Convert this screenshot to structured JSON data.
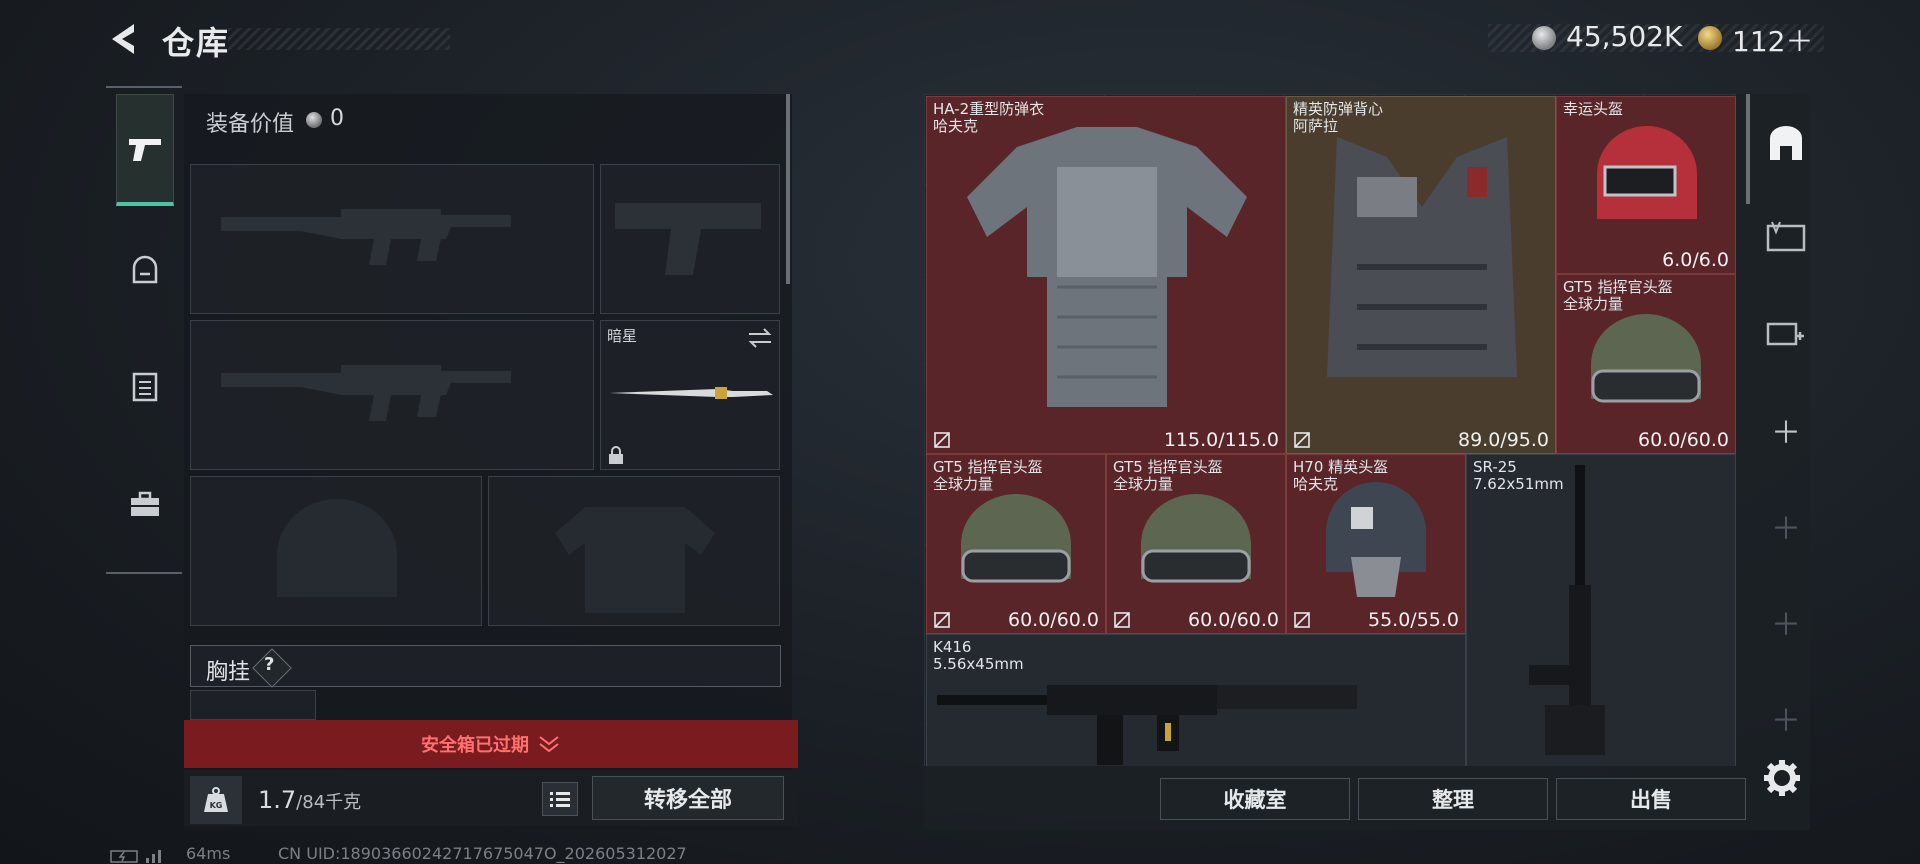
{
  "header": {
    "title": "仓库",
    "currency_main": "45,502K",
    "currency_premium": "112＋"
  },
  "loadout": {
    "value_label": "装备价值",
    "value": "0",
    "secondary_slot_name": "暗星",
    "chest_label": "胸挂",
    "chest_help": "?",
    "safe_box_status": "安全箱已过期",
    "weight_current": "1.7",
    "weight_max": "/84千克",
    "transfer_all": "转移全部",
    "weight_icon_text": "KG"
  },
  "warehouse": {
    "items": [
      {
        "name": "HA-2重型防弹衣\n哈夫克",
        "durability": "115.0/115.0",
        "color": "red"
      },
      {
        "name": "精英防弹背心\n阿萨拉",
        "durability": "89.0/95.0",
        "color": "tan"
      },
      {
        "name": "幸运头盔",
        "durability": "6.0/6.0",
        "color": "red"
      },
      {
        "name": "GT5 指挥官头盔\n全球力量",
        "durability": "60.0/60.0",
        "color": "red"
      },
      {
        "name": "GT5 指挥官头盔\n全球力量",
        "durability": "60.0/60.0",
        "color": "red"
      },
      {
        "name": "GT5 指挥官头盔\n全球力量",
        "durability": "60.0/60.0",
        "color": "red"
      },
      {
        "name": "H70 精英头盔\n哈夫克",
        "durability": "55.0/55.0",
        "color": "red"
      },
      {
        "name": "SR-25\n7.62x51mm",
        "durability": "",
        "color": "gray"
      },
      {
        "name": "K416\n5.56x45mm",
        "durability": "",
        "color": "gray"
      }
    ],
    "buttons": {
      "collection": "收藏室",
      "organize": "整理",
      "sell": "出售"
    }
  },
  "status_bar": {
    "ping": "64ms",
    "uid": "CN UID:18903660242717675047O_202605312027"
  },
  "colors": {
    "accent": "#4fc3a1",
    "danger": "#7a1c1f",
    "item_red": "#5a2529"
  }
}
